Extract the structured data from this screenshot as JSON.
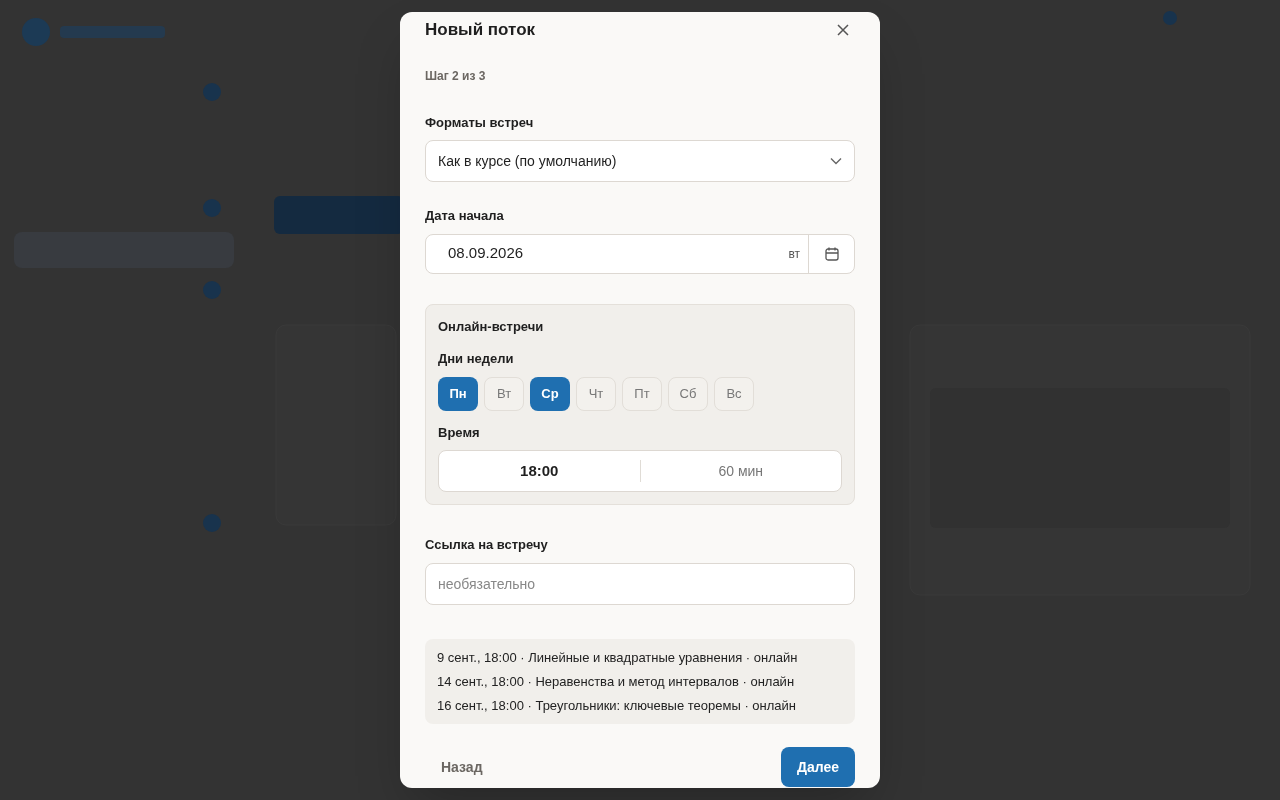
{
  "dialog": {
    "title": "Новый поток",
    "step": "Шаг 2 из 3",
    "format": {
      "label": "Форматы встреч",
      "value": "Как в курсе (по умолчанию)"
    },
    "start_date": {
      "label": "Дата начала",
      "value": "08.09.2026",
      "weekday": "вт"
    },
    "online": {
      "title": "Онлайн-встречи",
      "days_label": "Дни недели",
      "days": [
        {
          "label": "Пн",
          "selected": true
        },
        {
          "label": "Вт",
          "selected": false
        },
        {
          "label": "Ср",
          "selected": true
        },
        {
          "label": "Чт",
          "selected": false
        },
        {
          "label": "Пт",
          "selected": false
        },
        {
          "label": "Сб",
          "selected": false
        },
        {
          "label": "Вс",
          "selected": false
        }
      ],
      "time_label": "Время",
      "time": "18:00",
      "duration": "60 мин"
    },
    "link": {
      "label": "Ссылка на встречу",
      "placeholder": "необязательно"
    },
    "preview": [
      "9 сент., 18:00 · Линейные и квадратные уравнения · онлайн",
      "14 сент., 18:00 · Неравенства и метод интервалов · онлайн",
      "16 сент., 18:00 · Треугольники: ключевые теоремы · онлайн"
    ],
    "back": "Назад",
    "next": "Далее"
  }
}
